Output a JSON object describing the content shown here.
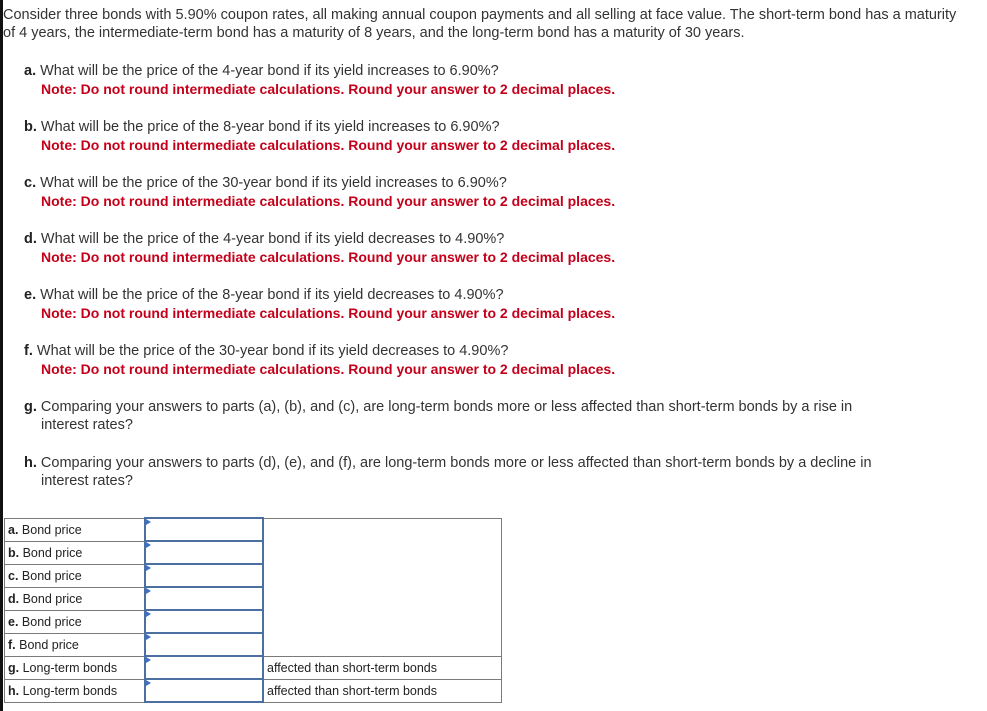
{
  "intro": "Consider three bonds with 5.90% coupon rates, all making annual coupon payments and all selling at face value. The short-term bond has a maturity of 4 years, the intermediate-term bond has a maturity of 8 years, and the long-term bond has a maturity of 30 years.",
  "note": "Note: Do not round intermediate calculations. Round your answer to 2 decimal places.",
  "questions": [
    {
      "letter": "a.",
      "text": "What will be the price of the 4-year bond if its yield increases to 6.90%?"
    },
    {
      "letter": "b.",
      "text": "What will be the price of the 8-year bond if its yield increases to 6.90%?"
    },
    {
      "letter": "c.",
      "text": "What will be the price of the 30-year bond if its yield increases to 6.90%?"
    },
    {
      "letter": "d.",
      "text": "What will be the price of the 4-year bond if its yield decreases to 4.90%?"
    },
    {
      "letter": "e.",
      "text": "What will be the price of the 8-year bond if its yield decreases to 4.90%?"
    },
    {
      "letter": "f.",
      "text": "What will be the price of the 30-year bond if its yield decreases to 4.90%?"
    },
    {
      "letter": "g.",
      "text": "Comparing your answers to parts (a), (b), and (c), are long-term bonds more or less affected than short-term bonds by a rise in",
      "cont": "interest rates?"
    },
    {
      "letter": "h.",
      "text": "Comparing your answers to parts (d), (e), and (f), are long-term bonds more or less affected than short-term bonds by a decline in",
      "cont": "interest rates?"
    }
  ],
  "answer_table": {
    "rows": [
      {
        "letter": "a.",
        "label": " Bond price",
        "value": "",
        "suffix": ""
      },
      {
        "letter": "b.",
        "label": " Bond price",
        "value": "",
        "suffix": ""
      },
      {
        "letter": "c.",
        "label": " Bond price",
        "value": "",
        "suffix": ""
      },
      {
        "letter": "d.",
        "label": " Bond price",
        "value": "",
        "suffix": ""
      },
      {
        "letter": "e.",
        "label": " Bond price",
        "value": "",
        "suffix": ""
      },
      {
        "letter": "f.",
        "label": " Bond price",
        "value": "",
        "suffix": ""
      },
      {
        "letter": "g.",
        "label": " Long-term bonds",
        "value": "",
        "suffix": "affected than short-term bonds"
      },
      {
        "letter": "h.",
        "label": " Long-term bonds",
        "value": "",
        "suffix": "affected than short-term bonds"
      }
    ]
  },
  "colors": {
    "note": "#c4001a",
    "input_border": "#4a6fa0",
    "input_marker": "#3d6fc2"
  }
}
